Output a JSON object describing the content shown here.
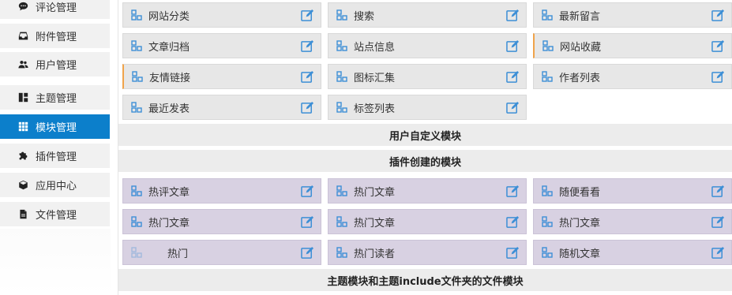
{
  "sidebar": {
    "items": [
      {
        "label": "评论管理",
        "icon": "comment-icon"
      },
      {
        "label": "附件管理",
        "icon": "inbox-icon"
      },
      {
        "label": "用户管理",
        "icon": "users-icon"
      },
      {
        "label": "主题管理",
        "icon": "layout-icon"
      },
      {
        "label": "模块管理",
        "icon": "grid-icon",
        "active": true
      },
      {
        "label": "插件管理",
        "icon": "puzzle-icon"
      },
      {
        "label": "应用中心",
        "icon": "cube-icon"
      },
      {
        "label": "文件管理",
        "icon": "file-icon"
      }
    ]
  },
  "system_modules": [
    "网站分类",
    "搜索",
    "最新留言",
    "文章归档",
    "站点信息",
    "网站收藏",
    "友情链接",
    "图标汇集",
    "作者列表",
    "最近发表",
    "标签列表"
  ],
  "sections": {
    "user_defined": "用户自定义模块",
    "plugin_created": "插件创建的模块",
    "theme_include": "主题模块和主题include文件夹的文件模块"
  },
  "plugin_modules": [
    "热评文章",
    "热门文章",
    "随便看看",
    "热门文章",
    "热门文章",
    "热门文章",
    "热门",
    "热门读者",
    "随机文章"
  ],
  "colors": {
    "accent": "#0c7fcb",
    "icon_blue": "#3d8fd6",
    "plugin_card": "#d8d1e2",
    "system_card": "#e7e7e7",
    "flag_orange": "#f0a34a"
  }
}
